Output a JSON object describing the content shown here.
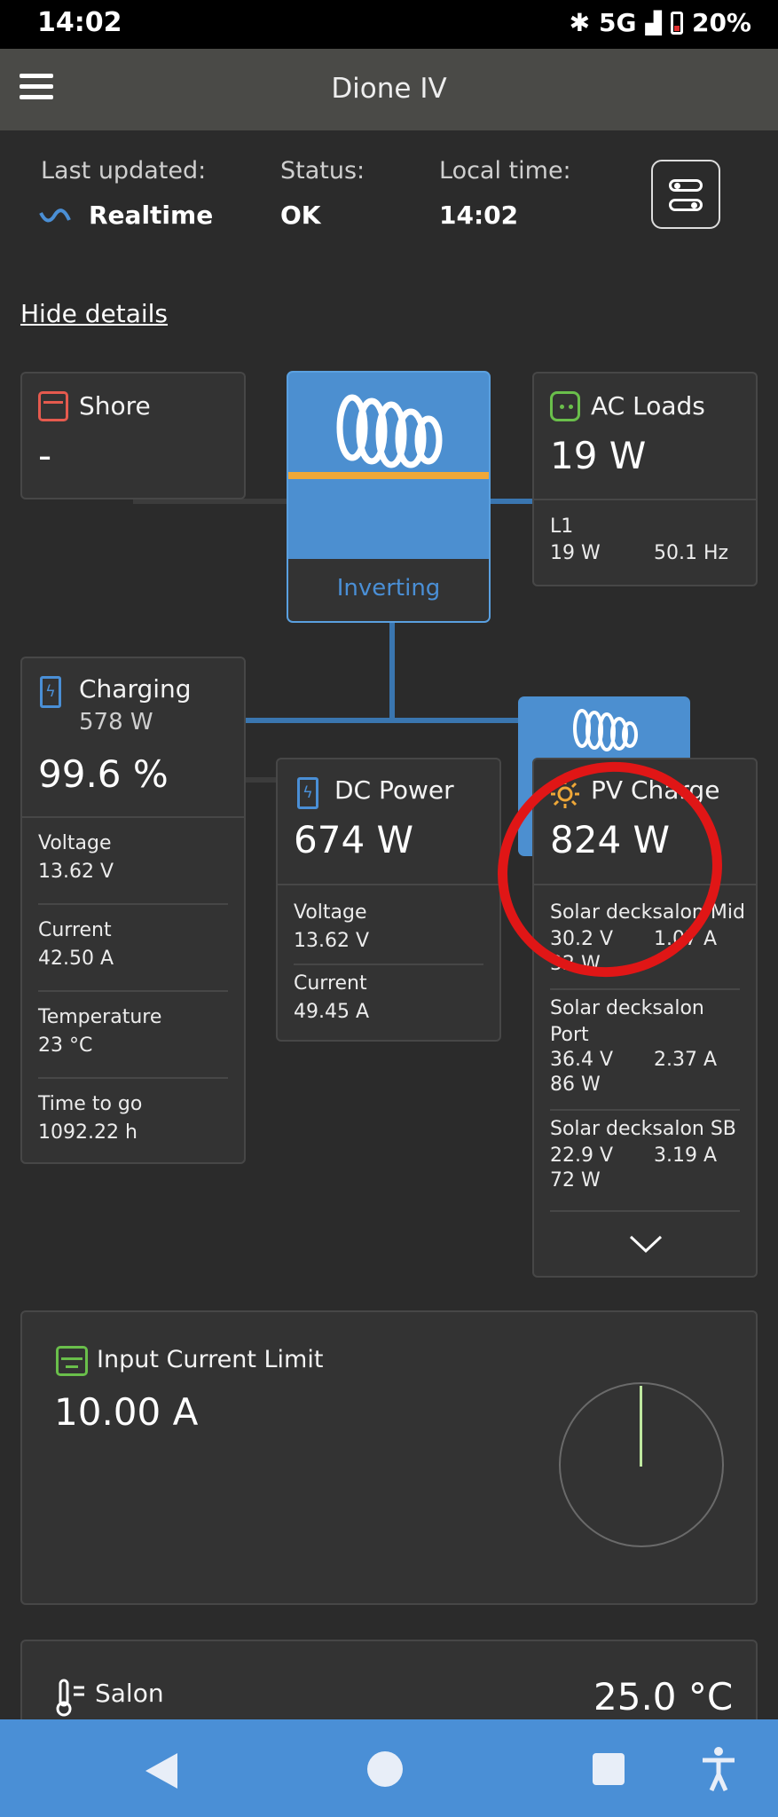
{
  "statusbar": {
    "time": "14:02",
    "network": "5G",
    "battery": "20%"
  },
  "header": {
    "title": "Dione IV"
  },
  "info": {
    "last_updated_label": "Last updated:",
    "last_updated_value": "Realtime",
    "status_label": "Status:",
    "status_value": "OK",
    "local_time_label": "Local time:",
    "local_time_value": "14:02"
  },
  "hide_details": "Hide details",
  "shore": {
    "title": "Shore",
    "value": "-"
  },
  "inverter": {
    "state": "Inverting"
  },
  "ac_loads": {
    "title": "AC Loads",
    "value": "19 W",
    "phase": "L1",
    "phase_power": "19 W",
    "frequency": "50.1 Hz"
  },
  "battery": {
    "title": "Charging",
    "power": "578 W",
    "soc": "99.6 %",
    "rows": [
      {
        "label": "Voltage",
        "value": "13.62 V"
      },
      {
        "label": "Current",
        "value": "42.50 A"
      },
      {
        "label": "Temperature",
        "value": "23 °C"
      },
      {
        "label": "Time to go",
        "value": "1092.22 h"
      }
    ]
  },
  "dc_power": {
    "title": "DC Power",
    "value": "674 W",
    "rows": [
      {
        "label": "Voltage",
        "value": "13.62 V"
      },
      {
        "label": "Current",
        "value": "49.45 A"
      }
    ]
  },
  "pv": {
    "title": "PV Charge",
    "value": "824 W",
    "chargers": [
      {
        "name": "Solar decksalon Mid",
        "voltage": "30.2 V",
        "current": "1.07 A",
        "power": "32 W"
      },
      {
        "name": "Solar decksalon Port",
        "voltage": "36.4 V",
        "current": "2.37 A",
        "power": "86 W"
      },
      {
        "name": "Solar decksalon SB",
        "voltage": "22.9 V",
        "current": "3.19 A",
        "power": "72 W"
      }
    ]
  },
  "input_limit": {
    "title": "Input Current Limit",
    "value": "10.00 A"
  },
  "salon": {
    "title": "Salon",
    "value": "25.0 °C"
  },
  "colors": {
    "accent": "#4a8fd6",
    "annotation": "#e01616",
    "bar": "#f0a838",
    "green_icon": "#6abf4b",
    "red_icon": "#e55a4e"
  }
}
